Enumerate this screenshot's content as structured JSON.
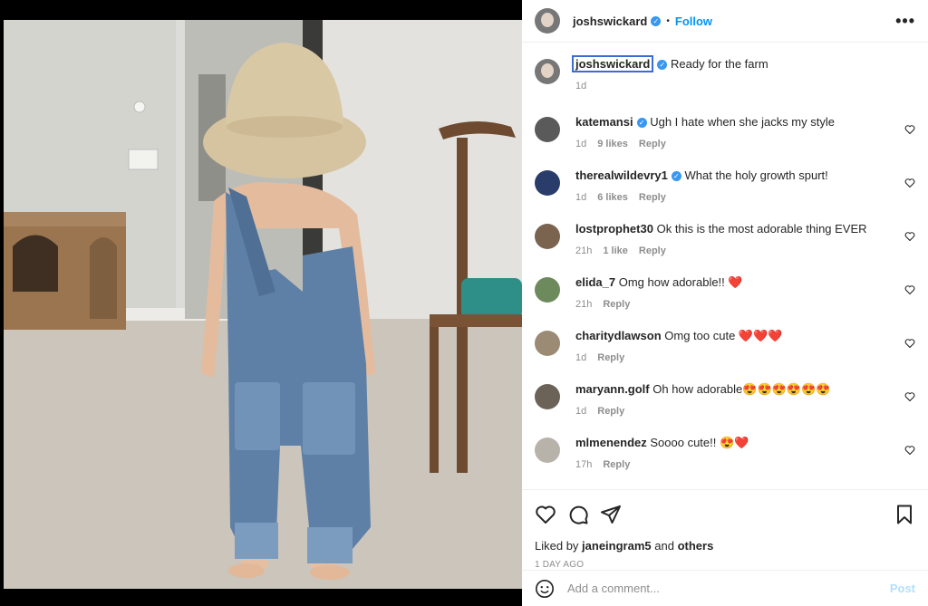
{
  "post": {
    "author": "joshswickard",
    "follow_label": "Follow",
    "more_label": "•••",
    "caption_text": "Ready for the farm",
    "caption_time": "1d"
  },
  "comments": [
    {
      "user": "katemansi",
      "verified": true,
      "text": "Ugh I hate when she jacks my style",
      "time": "1d",
      "likes": "9 likes",
      "reply": "Reply",
      "avatar_color": "#5a5a5a"
    },
    {
      "user": "therealwildevry1",
      "verified": true,
      "text": "What the holy growth spurt!",
      "time": "1d",
      "likes": "6 likes",
      "reply": "Reply",
      "avatar_color": "#2a3c6a"
    },
    {
      "user": "lostprophet30",
      "verified": false,
      "text": "Ok this is the most adorable thing EVER",
      "time": "21h",
      "likes": "1 like",
      "reply": "Reply",
      "avatar_color": "#7a6450"
    },
    {
      "user": "elida_7",
      "verified": false,
      "text": "Omg how adorable!! ❤️",
      "time": "21h",
      "likes": "",
      "reply": "Reply",
      "avatar_color": "#6d8a5c"
    },
    {
      "user": "charitydlawson",
      "verified": false,
      "text": "Omg too cute ❤️❤️❤️",
      "time": "1d",
      "likes": "",
      "reply": "Reply",
      "avatar_color": "#9b8a74"
    },
    {
      "user": "maryann.golf",
      "verified": false,
      "text": "Oh how adorable😍😍😍😍😍😍",
      "time": "1d",
      "likes": "",
      "reply": "Reply",
      "avatar_color": "#6b6258"
    },
    {
      "user": "mlmenendez",
      "verified": false,
      "text": "Soooo cute!! 😍❤️",
      "time": "17h",
      "likes": "",
      "reply": "Reply",
      "avatar_color": "#b7b2aa"
    }
  ],
  "liked_by": {
    "prefix": "Liked by",
    "user": "janeingram5",
    "and": "and",
    "others": "others"
  },
  "time_ago": "1 DAY AGO",
  "add_comment": {
    "placeholder": "Add a comment...",
    "post_label": "Post"
  }
}
